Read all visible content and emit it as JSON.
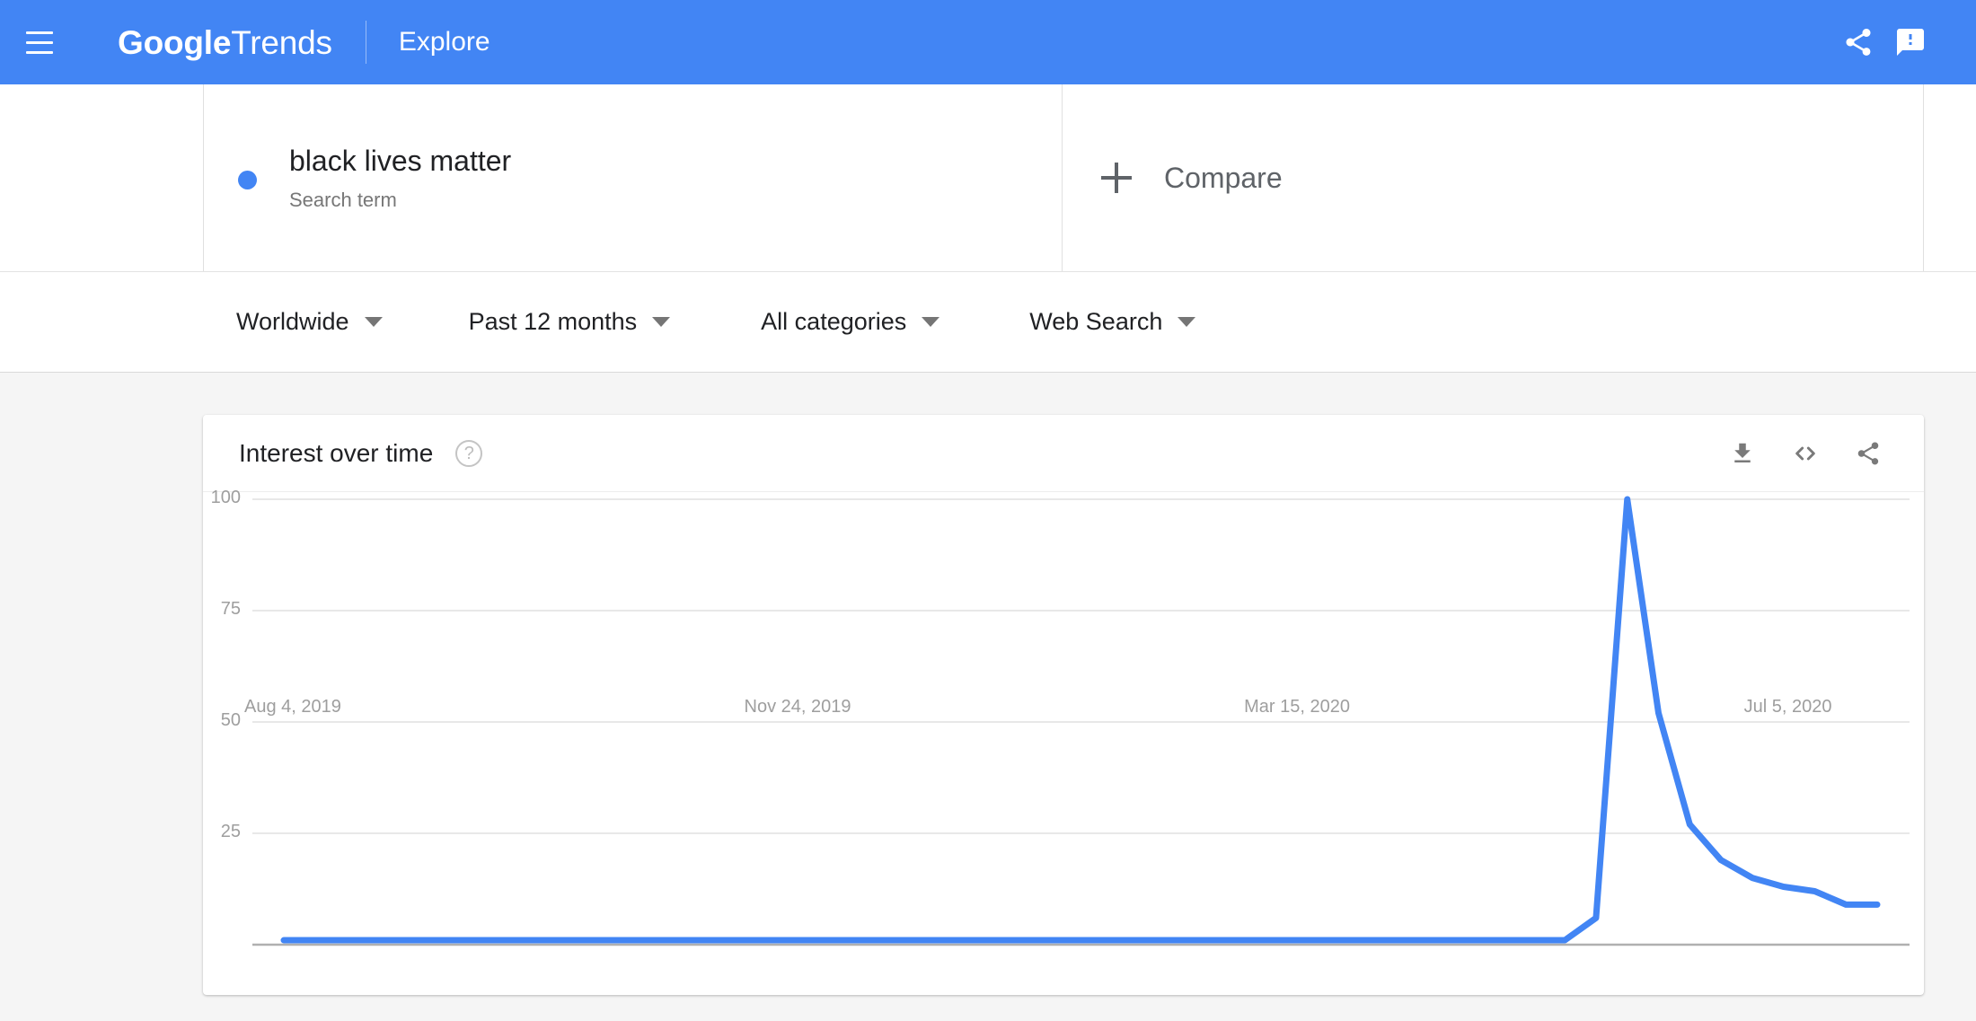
{
  "appbar": {
    "menu_icon": "hamburger-menu-icon",
    "brand_bold": "Google",
    "brand_light": "Trends",
    "explore": "Explore",
    "share_icon": "share-icon",
    "feedback_icon": "feedback-icon"
  },
  "term": {
    "title": "black lives matter",
    "subtitle": "Search term",
    "dot_color": "#4285f4"
  },
  "compare": {
    "label": "Compare",
    "plus_icon": "plus-icon"
  },
  "filters": [
    {
      "label": "Worldwide"
    },
    {
      "label": "Past 12 months"
    },
    {
      "label": "All categories"
    },
    {
      "label": "Web Search"
    }
  ],
  "card": {
    "title": "Interest over time",
    "help_icon": "?",
    "download_icon": "download-icon",
    "embed_icon": "embed-code-icon",
    "share_icon": "share-icon"
  },
  "chart_data": {
    "type": "line",
    "title": "Interest over time",
    "xlabel": "",
    "ylabel": "",
    "ylim": [
      0,
      100
    ],
    "grid": true,
    "legend": false,
    "line_color": "#4285f4",
    "series_name": "black lives matter",
    "y_ticks": [
      100,
      75,
      50,
      25
    ],
    "x_tick_labels": [
      "Aug 4, 2019",
      "Nov 24, 2019",
      "Mar 15, 2020",
      "Jul 5, 2020"
    ],
    "x_tick_indices": [
      0,
      16,
      32,
      48
    ],
    "x": [
      "Aug 4, 2019",
      "Aug 11, 2019",
      "Aug 18, 2019",
      "Aug 25, 2019",
      "Sep 1, 2019",
      "Sep 8, 2019",
      "Sep 15, 2019",
      "Sep 22, 2019",
      "Sep 29, 2019",
      "Oct 6, 2019",
      "Oct 13, 2019",
      "Oct 20, 2019",
      "Oct 27, 2019",
      "Nov 3, 2019",
      "Nov 10, 2019",
      "Nov 17, 2019",
      "Nov 24, 2019",
      "Dec 1, 2019",
      "Dec 8, 2019",
      "Dec 15, 2019",
      "Dec 22, 2019",
      "Dec 29, 2019",
      "Jan 5, 2020",
      "Jan 12, 2020",
      "Jan 19, 2020",
      "Jan 26, 2020",
      "Feb 2, 2020",
      "Feb 9, 2020",
      "Feb 16, 2020",
      "Feb 23, 2020",
      "Mar 1, 2020",
      "Mar 8, 2020",
      "Mar 15, 2020",
      "Mar 22, 2020",
      "Mar 29, 2020",
      "Apr 5, 2020",
      "Apr 12, 2020",
      "Apr 19, 2020",
      "Apr 26, 2020",
      "May 3, 2020",
      "May 10, 2020",
      "May 17, 2020",
      "May 24, 2020",
      "May 31, 2020",
      "Jun 7, 2020",
      "Jun 14, 2020",
      "Jun 21, 2020",
      "Jun 28, 2020",
      "Jul 5, 2020",
      "Jul 12, 2020",
      "Jul 19, 2020",
      "Jul 26, 2020"
    ],
    "values": [
      1,
      1,
      1,
      1,
      1,
      1,
      1,
      1,
      1,
      1,
      1,
      1,
      1,
      1,
      1,
      1,
      1,
      1,
      1,
      1,
      1,
      1,
      1,
      1,
      1,
      1,
      1,
      1,
      1,
      1,
      1,
      1,
      1,
      1,
      1,
      1,
      1,
      1,
      1,
      1,
      1,
      1,
      6,
      100,
      52,
      27,
      19,
      15,
      13,
      12,
      9,
      9
    ],
    "peak_value": 100,
    "peak_label": "May 31, 2020"
  }
}
